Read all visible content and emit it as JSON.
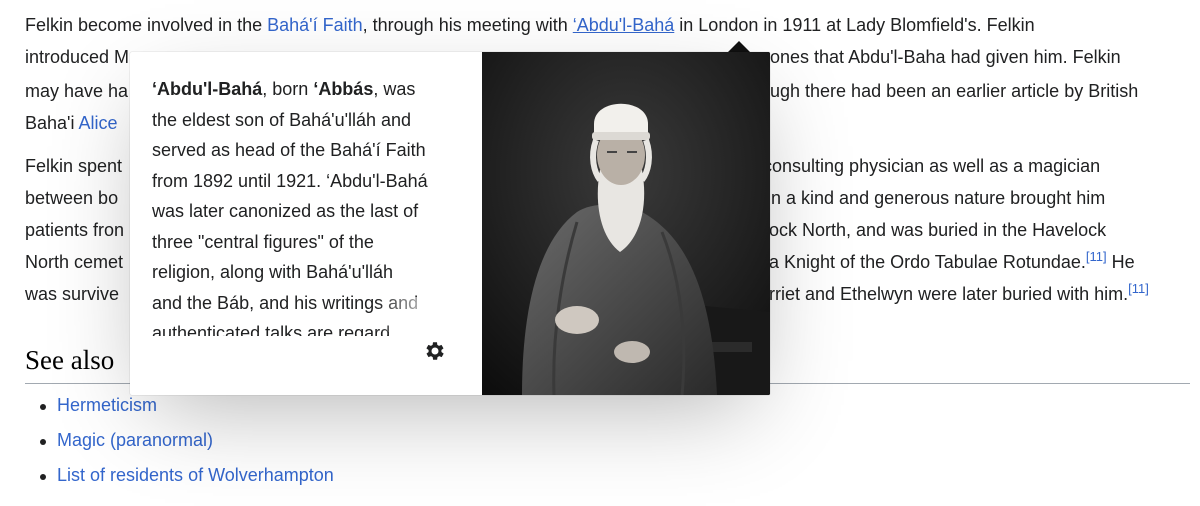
{
  "article": {
    "lines": [
      {
        "parts": [
          "Felkin become involved in the ",
          "Bahá'í Faith",
          ", through his meeting with ",
          "‘Abdu'l-Bahá",
          " in London in 1911 at Lady Blomfield's. Felkin"
        ]
      },
      {
        "left": "introduced M",
        "right": "ones that Abdu'l-Baha had given him. Felkin"
      },
      {
        "left": "may have ha",
        "right": "ugh there had been an earlier article by British"
      },
      {
        "left": "Baha'i ",
        "left_link": "Alice"
      },
      {
        "left": "Felkin spent",
        "right": "consulting physician as well as a magician"
      },
      {
        "left": "between bo",
        "right": "n a kind and generous nature brought him"
      },
      {
        "left": "patients fron",
        "right": "ock North, and was buried in the Havelock"
      },
      {
        "left": "North cemet",
        "right": "a Knight of the Ordo Tabulae Rotundae.",
        "ref": "[11]",
        "tail": " He"
      },
      {
        "left": "was survive",
        "right": "rriet and Ethelwyn were later buried with him.",
        "ref": "[11]"
      }
    ],
    "see_also_heading": "See also",
    "see_also_items": [
      "Hermeticism",
      "Magic (paranormal)",
      "List of residents of Wolverhampton"
    ]
  },
  "popup": {
    "lines": [
      [
        {
          "t": "‘Abdu'l-Bahá",
          "b": true
        },
        {
          "t": ", born "
        },
        {
          "t": "‘Abbás",
          "b": true
        },
        {
          "t": ", was"
        }
      ],
      [
        {
          "t": "the eldest son of Bahá'u'lláh and"
        }
      ],
      [
        {
          "t": "served as head of the Bahá'í Faith"
        }
      ],
      [
        {
          "t": "from 1892 until 1921. ‘Abdu'l-Bahá"
        }
      ],
      [
        {
          "t": "was later canonized as the last of"
        }
      ],
      [
        {
          "t": "three \"central figures\" of the"
        }
      ],
      [
        {
          "t": "religion, along with Bahá'u'lláh"
        }
      ],
      [
        {
          "t": "and the Báb, and his writings and"
        }
      ],
      [
        {
          "t": "authenticated talks are regard"
        }
      ]
    ],
    "settings_icon": "gear-icon",
    "image_subject": "portrait-photo"
  }
}
